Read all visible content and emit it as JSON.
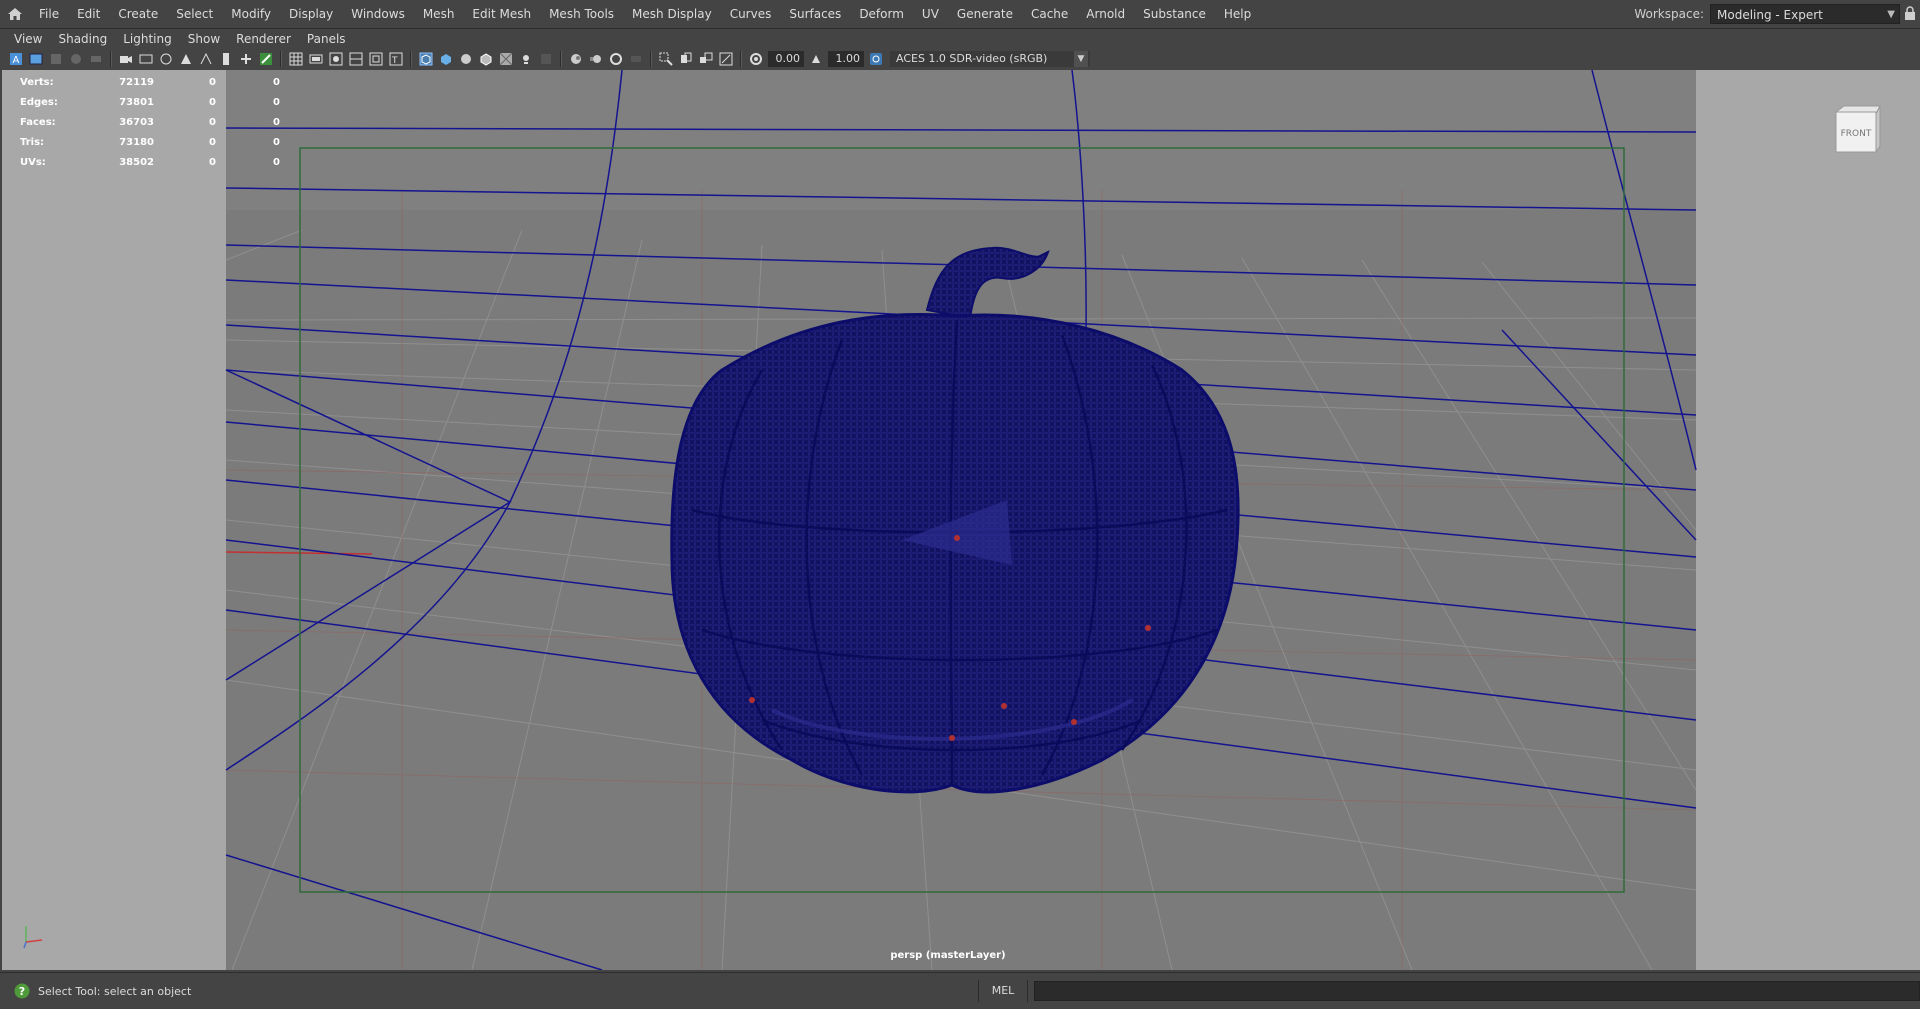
{
  "menubar": {
    "items": [
      "File",
      "Edit",
      "Create",
      "Select",
      "Modify",
      "Display",
      "Windows",
      "Mesh",
      "Edit Mesh",
      "Mesh Tools",
      "Mesh Display",
      "Curves",
      "Surfaces",
      "Deform",
      "UV",
      "Generate",
      "Cache",
      "Arnold",
      "Substance",
      "Help"
    ],
    "workspace_label": "Workspace:",
    "workspace_value": "Modeling - Expert"
  },
  "panel_menu": [
    "View",
    "Shading",
    "Lighting",
    "Show",
    "Renderer",
    "Panels"
  ],
  "toolbar": {
    "exposure": "0.00",
    "gamma": "1.00",
    "color_space": "ACES 1.0 SDR-video (sRGB)"
  },
  "hud": {
    "rows": [
      {
        "label": "Verts:",
        "total": "72119",
        "selected": "0",
        "component": "0"
      },
      {
        "label": "Edges:",
        "total": "73801",
        "selected": "0",
        "component": "0"
      },
      {
        "label": "Faces:",
        "total": "36703",
        "selected": "0",
        "component": "0"
      },
      {
        "label": "Tris:",
        "total": "73180",
        "selected": "0",
        "component": "0"
      },
      {
        "label": "UVs:",
        "total": "38502",
        "selected": "0",
        "component": "0"
      }
    ]
  },
  "viewport": {
    "camera_label": "persp (masterLayer)",
    "view_cube_face": "FRONT",
    "wire_color": "#0a0a7a"
  },
  "statusbar": {
    "help_text": "Select Tool: select an object",
    "command_language": "MEL"
  }
}
